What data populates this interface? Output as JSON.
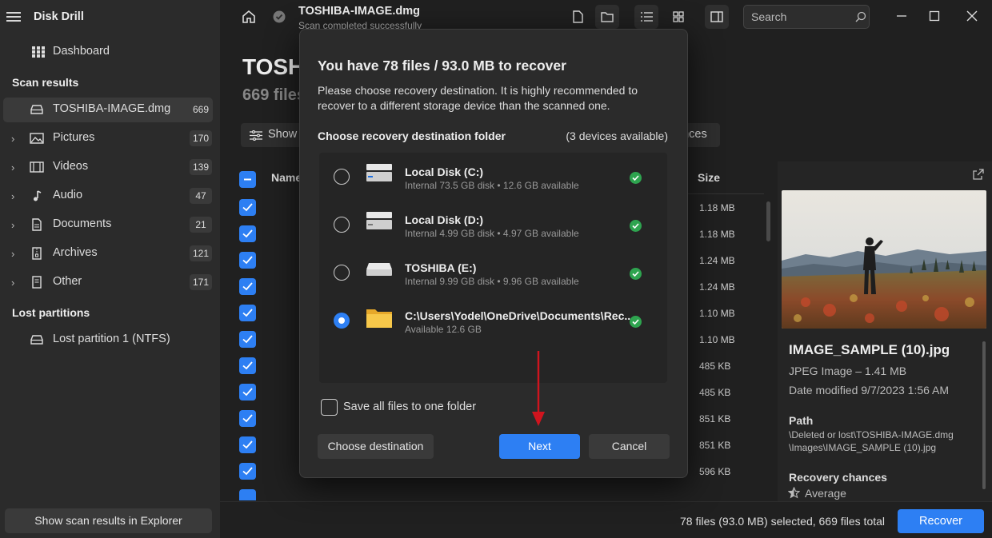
{
  "app": {
    "title": "Disk Drill"
  },
  "sidebar": {
    "dashboard_label": "Dashboard",
    "scan_results_heading": "Scan results",
    "selected_item": {
      "label": "TOSHIBA-IMAGE.dmg",
      "count": "669"
    },
    "categories": [
      {
        "label": "Pictures",
        "count": "170",
        "icon": "image-icon"
      },
      {
        "label": "Videos",
        "count": "139",
        "icon": "film-icon"
      },
      {
        "label": "Audio",
        "count": "47",
        "icon": "music-note-icon"
      },
      {
        "label": "Documents",
        "count": "21",
        "icon": "document-icon"
      },
      {
        "label": "Archives",
        "count": "121",
        "icon": "archive-icon"
      },
      {
        "label": "Other",
        "count": "171",
        "icon": "file-icon"
      }
    ],
    "lost_partitions_heading": "Lost partitions",
    "lost_partition_item": "Lost partition 1 (NTFS)",
    "explorer_button": "Show scan results in Explorer"
  },
  "header": {
    "file_title": "TOSHIBA-IMAGE.dmg",
    "status": "Scan completed successfully",
    "search_placeholder": "Search"
  },
  "main": {
    "title_partial": "TOSHI",
    "files_partial": "669 files",
    "show_button": "Show",
    "chances_button_partial": "ances",
    "col_name": "Name",
    "col_size": "Size",
    "sizes": [
      "1.18 MB",
      "1.18 MB",
      "1.24 MB",
      "1.24 MB",
      "1.10 MB",
      "1.10 MB",
      "485 KB",
      "485 KB",
      "851 KB",
      "851 KB",
      "596 KB"
    ]
  },
  "preview": {
    "file_name": "IMAGE_SAMPLE (10).jpg",
    "type_size": "JPEG Image – 1.41 MB",
    "modified": "Date modified 9/7/2023 1:56 AM",
    "path_heading": "Path",
    "path_line1": "\\Deleted or lost\\TOSHIBA-IMAGE.dmg",
    "path_line2": "\\Images\\IMAGE_SAMPLE (10).jpg",
    "recovery_heading": "Recovery chances",
    "recovery_value": "Average"
  },
  "footer": {
    "selection_status": "78 files (93.0 MB) selected, 669 files total",
    "recover_button": "Recover"
  },
  "modal": {
    "title": "You have 78 files / 93.0 MB to recover",
    "description": "Please choose recovery destination. It is highly recommended to recover to a different storage device than the scanned one.",
    "choose_label": "Choose recovery destination folder",
    "devices_count": "(3 devices available)",
    "devices": [
      {
        "name": "Local Disk (C:)",
        "info": "Internal 73.5 GB disk • 12.6 GB available",
        "selected": false
      },
      {
        "name": "Local Disk (D:)",
        "info": "Internal 4.99 GB disk • 4.97 GB available",
        "selected": false
      },
      {
        "name": "TOSHIBA (E:)",
        "info": "Internal 9.99 GB disk • 9.96 GB available",
        "selected": false
      },
      {
        "name": "C:\\Users\\Yodel\\OneDrive\\Documents\\Rec...",
        "info": "Available 12.6 GB",
        "selected": true
      }
    ],
    "save_all_label": "Save all files to one folder",
    "choose_destination_button": "Choose destination",
    "next_button": "Next",
    "cancel_button": "Cancel"
  },
  "colors": {
    "accent": "#2d7ff3",
    "ok": "#2ea44f",
    "arrow": "#d0141e"
  }
}
